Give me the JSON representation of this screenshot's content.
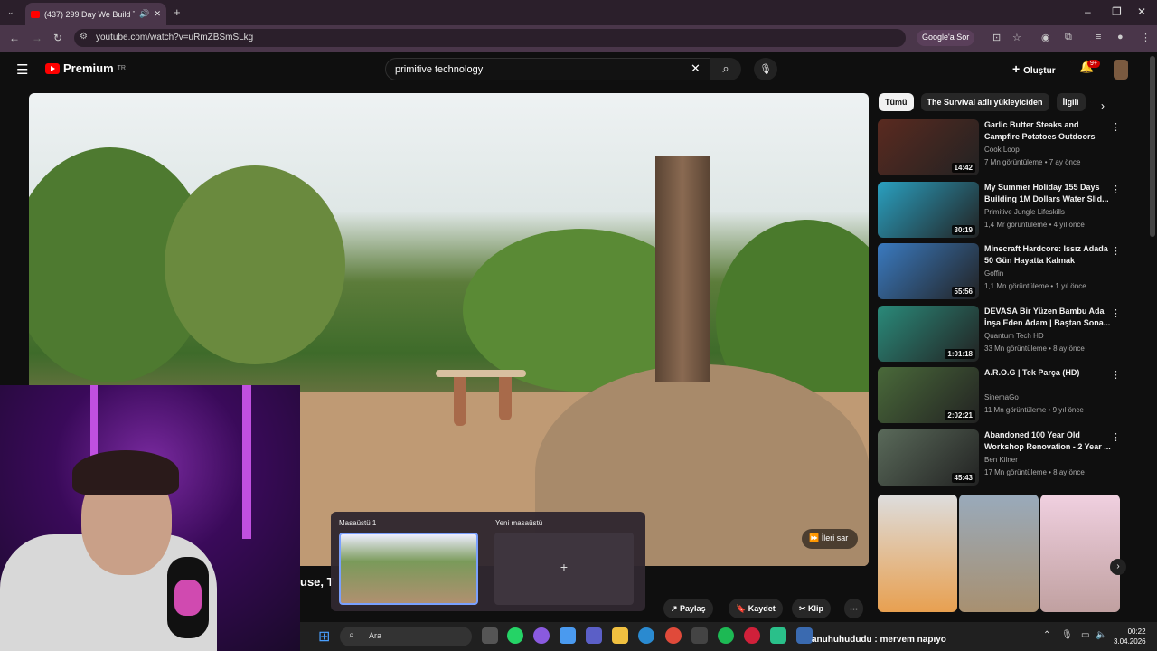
{
  "browser": {
    "tab_title": "(437) 299 Day We Build Top",
    "url": "youtube.com/watch?v=uRmZBSmSLkg",
    "google_sor": "Google'a Sor"
  },
  "youtube": {
    "logo_text": "Premium",
    "logo_sup": "TR",
    "search_value": "primitive technology",
    "create_label": "Oluştur",
    "notif_badge": "9+",
    "skip_label": "İleri sar",
    "video_title_partial": "use, T",
    "actions": [
      "Paylaş",
      "Kaydet",
      "Klip"
    ],
    "chips": [
      "Tümü",
      "The Survival adlı yükleyiciden",
      "İlgili"
    ]
  },
  "recommendations": [
    {
      "title": "Garlic Butter Steaks and Campfire Potatoes Outdoors",
      "channel": "Cook Loop",
      "meta": "7 Mn görüntüleme • 7 ay önce",
      "duration": "14:42",
      "color": "#5a2a20"
    },
    {
      "title": "My Summer Holiday 155 Days Building 1M Dollars Water Slid...",
      "channel": "Primitive Jungle Lifeskills",
      "meta": "1,4 Mr görüntüleme • 4 yıl önce",
      "duration": "30:19",
      "color": "#2aa0c0"
    },
    {
      "title": "Minecraft Hardcore: Issız Adada 50 Gün Hayatta Kalmak",
      "channel": "Goffin",
      "meta": "1,1 Mn görüntüleme • 1 yıl önce",
      "duration": "55:56",
      "color": "#3a7ac0"
    },
    {
      "title": "DEVASA Bir Yüzen Bambu Ada İnşa Eden Adam | Baştan Sona...",
      "channel": "Quantum Tech HD",
      "meta": "33 Mn görüntüleme • 8 ay önce",
      "duration": "1:01:18",
      "color": "#2a8a7a"
    },
    {
      "title": "A.R.O.G | Tek Parça (HD)",
      "channel": "SinemaGo",
      "meta": "11 Mn görüntüleme • 9 yıl önce",
      "duration": "2:02:21",
      "color": "#4a6a3a"
    },
    {
      "title": "Abandoned 100 Year Old Workshop Renovation - 2 Year ...",
      "channel": "Ben Kilner",
      "meta": "17 Mn görüntüleme • 8 ay önce",
      "duration": "45:43",
      "color": "#5a6a5a"
    }
  ],
  "desktop": {
    "desk1": "Masaüstü 1",
    "desk2": "Yeni masaüstü"
  },
  "taskbar": {
    "search_label": "Ara",
    "chat_text": "anuhuhududu : mervem napıyo",
    "time": "00:22",
    "date": "3.04.2026"
  }
}
